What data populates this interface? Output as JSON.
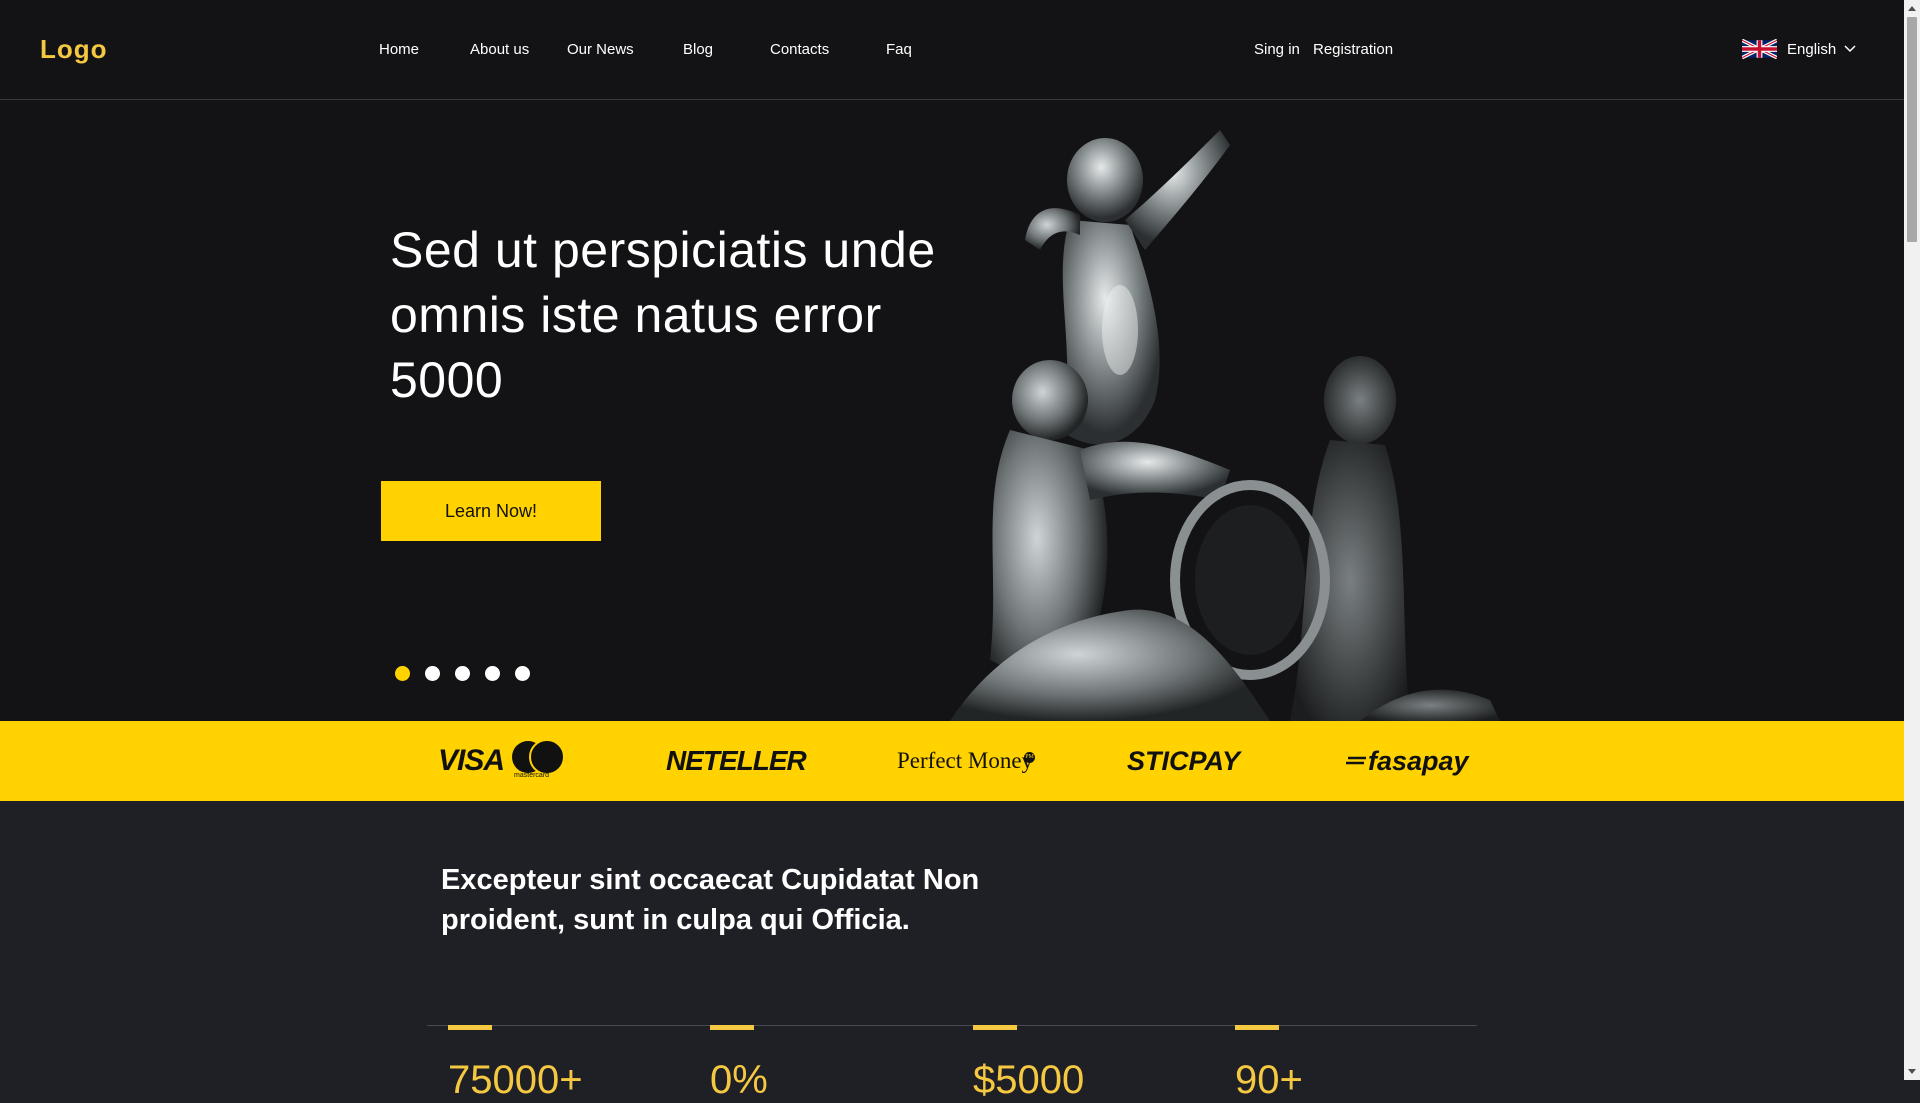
{
  "header": {
    "logo": "Logo",
    "nav": [
      {
        "label": "Home"
      },
      {
        "label": "About us"
      },
      {
        "label": "Our News"
      },
      {
        "label": "Blog"
      },
      {
        "label": "Contacts"
      },
      {
        "label": "Faq"
      }
    ],
    "auth": {
      "signin": "Sing in",
      "register": "Registration"
    },
    "language": {
      "label": "English",
      "flag_icon": "uk-flag-icon",
      "chevron_icon": "chevron-down-icon"
    }
  },
  "hero": {
    "title": "Sed ut perspiciatis unde omnis iste natus error 5000",
    "cta": "Learn Now!",
    "slides": 5,
    "active_slide": 1,
    "image": "cherub-statue-image"
  },
  "payments": {
    "visa": "VISA",
    "mastercard": "mastercard",
    "neteller": "NETELLER",
    "perfect_money": "Perfect Money",
    "sticpay": "STICPAY",
    "fasapay": "fasapay"
  },
  "about": {
    "title": "Excepteur sint occaecat Cupidatat Non proident, sunt in culpa qui Officia."
  },
  "stats": [
    {
      "value": "75000+"
    },
    {
      "value": "0%"
    },
    {
      "value": "$5000"
    },
    {
      "value": "90+"
    }
  ],
  "colors": {
    "accent": "#ffd200",
    "logo": "#f5c842",
    "background_dark": "#131315",
    "section_bg": "#1f2026"
  }
}
